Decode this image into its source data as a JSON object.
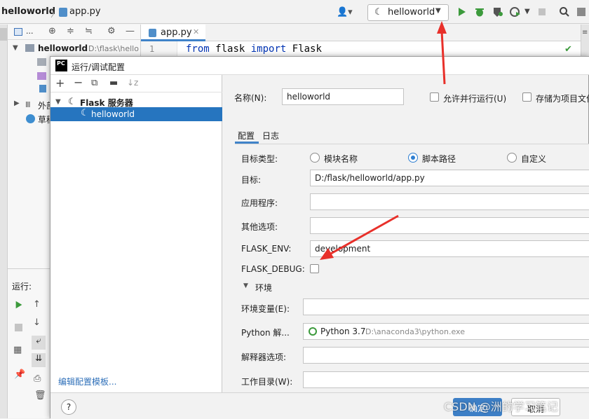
{
  "topbar": {
    "project": "helloworld",
    "file": "app.py",
    "run_config": "helloworld"
  },
  "project_panel": {
    "dropdown": "...",
    "root_name": "helloworld",
    "root_path": "D:\\flask\\hello",
    "external_label": "外部",
    "scratch_label": "草稿",
    "run_label": "运行:"
  },
  "editor": {
    "tab": "app.py",
    "line_number": "1",
    "code": {
      "kw1": "from",
      "mod": "flask",
      "kw2": "import",
      "cls": "Flask"
    }
  },
  "dialog": {
    "title": "运行/调试配置",
    "tree_group": "Flask 服务器",
    "tree_item": "helloworld",
    "edit_templates": "编辑配置模板...",
    "name_label": "名称(N):",
    "name_value": "helloworld",
    "allow_parallel": "允许并行运行(U)",
    "store_as_file": "存储为项目文件",
    "tab_config": "配置",
    "tab_logs": "日志",
    "target_type_label": "目标类型:",
    "target_options": [
      "模块名称",
      "脚本路径",
      "自定义"
    ],
    "target_label": "目标:",
    "target_value": "D:/flask/helloworld/app.py",
    "app_label": "应用程序:",
    "other_label": "其他选项:",
    "flask_env_label": "FLASK_ENV:",
    "flask_env_value": "development",
    "flask_debug_label": "FLASK_DEBUG:",
    "env_section": "环境",
    "env_vars_label": "环境变量(E):",
    "python_label": "Python 解...",
    "python_version": "Python 3.7",
    "python_path": "D:\\anaconda3\\python.exe",
    "interp_opts_label": "解释器选项:",
    "workdir_label": "工作目录(W):",
    "ok": "确定",
    "cancel": "取消",
    "help": "?"
  },
  "watermark": "CSDN @洲的学习笔记",
  "colors": {
    "accent": "#2f7fd1",
    "selection": "#2675bf",
    "run_green": "#3c9a3c",
    "annotation": "#e8302a"
  }
}
